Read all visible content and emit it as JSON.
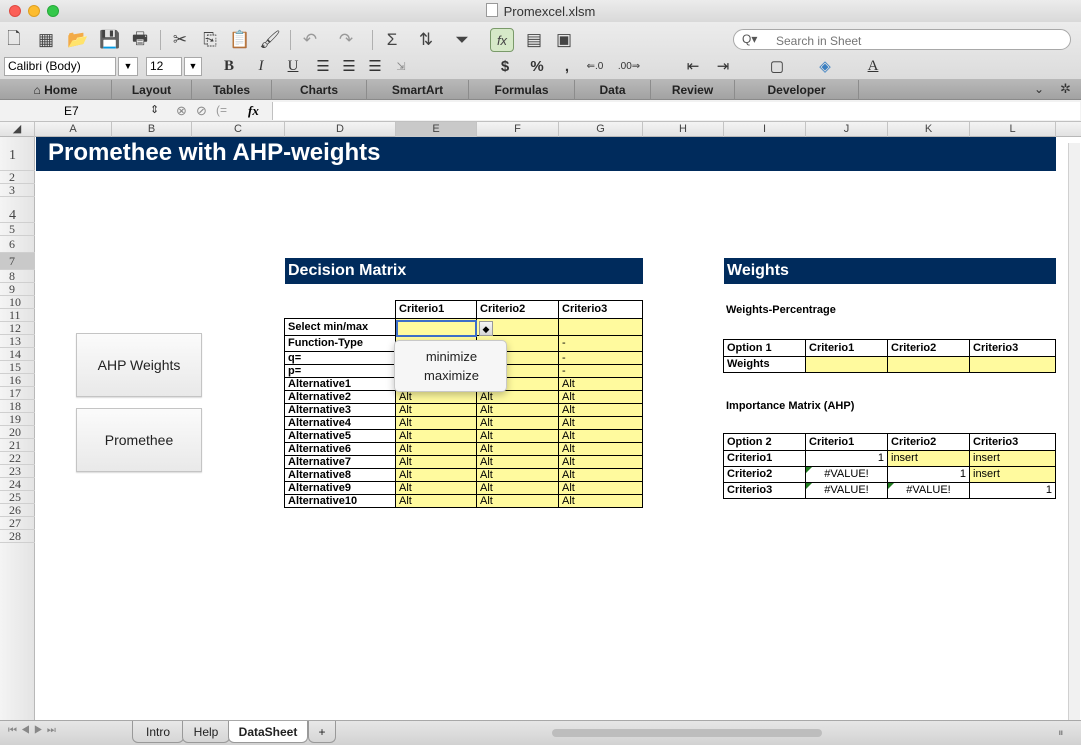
{
  "window": {
    "title": "Promexcel.xlsm"
  },
  "toolbar": {
    "search_placeholder": "Search in Sheet",
    "search_glyph": "Q▾"
  },
  "format": {
    "font_name": "Calibri (Body)",
    "font_size": "12",
    "bold": "B",
    "italic": "I",
    "underline": "U",
    "currency": "$",
    "percent": "%",
    "comma": ",",
    "font_color": "A"
  },
  "ribbon_tabs": [
    "Home",
    "Layout",
    "Tables",
    "Charts",
    "SmartArt",
    "Formulas",
    "Data",
    "Review",
    "Developer"
  ],
  "formula_bar": {
    "cell_ref": "E7",
    "fx": "fx",
    "formula": ""
  },
  "columns": [
    "A",
    "B",
    "C",
    "D",
    "E",
    "F",
    "G",
    "H",
    "I",
    "J",
    "K",
    "L"
  ],
  "selected_column": "E",
  "rows": [
    "1",
    "2",
    "3",
    "4",
    "5",
    "6",
    "7",
    "8",
    "9",
    "10",
    "11",
    "12",
    "13",
    "14",
    "15",
    "16",
    "17",
    "18",
    "19",
    "20",
    "21",
    "22",
    "23",
    "24",
    "25",
    "26",
    "27",
    "28"
  ],
  "selected_row": "7",
  "sheet": {
    "title": "Promethee with AHP-weights",
    "buttons": {
      "ahp": "AHP Weights",
      "promethee": "Promethee"
    },
    "decision_matrix": {
      "heading": "Decision Matrix",
      "header": [
        "",
        "Criterio1",
        "Criterio2",
        "Criterio3"
      ],
      "param_rows": [
        {
          "label": "Select min/max",
          "values": [
            "",
            "",
            ""
          ]
        },
        {
          "label": "Function-Type",
          "values": [
            "",
            "",
            "-"
          ]
        },
        {
          "label": "q=",
          "values": [
            "",
            "",
            "-"
          ]
        },
        {
          "label": "p=",
          "values": [
            "",
            "",
            "-"
          ]
        }
      ],
      "alternatives": [
        {
          "label": "Alternative1",
          "values": [
            "Alt",
            "Alt",
            "Alt"
          ]
        },
        {
          "label": "Alternative2",
          "values": [
            "Alt",
            "Alt",
            "Alt"
          ]
        },
        {
          "label": "Alternative3",
          "values": [
            "Alt",
            "Alt",
            "Alt"
          ]
        },
        {
          "label": "Alternative4",
          "values": [
            "Alt",
            "Alt",
            "Alt"
          ]
        },
        {
          "label": "Alternative5",
          "values": [
            "Alt",
            "Alt",
            "Alt"
          ]
        },
        {
          "label": "Alternative6",
          "values": [
            "Alt",
            "Alt",
            "Alt"
          ]
        },
        {
          "label": "Alternative7",
          "values": [
            "Alt",
            "Alt",
            "Alt"
          ]
        },
        {
          "label": "Alternative8",
          "values": [
            "Alt",
            "Alt",
            "Alt"
          ]
        },
        {
          "label": "Alternative9",
          "values": [
            "Alt",
            "Alt",
            "Alt"
          ]
        },
        {
          "label": "Alternative10",
          "values": [
            "Alt",
            "Alt",
            "Alt"
          ]
        }
      ]
    },
    "dropdown": {
      "items": [
        "minimize",
        "maximize"
      ]
    },
    "weights": {
      "heading": "Weights",
      "subheading": "Weights-Percentrage",
      "table": {
        "header": [
          "Option 1",
          "Criterio1",
          "Criterio2",
          "Criterio3"
        ],
        "rows": [
          {
            "label": "Weights",
            "values": [
              "",
              "",
              ""
            ]
          }
        ]
      },
      "importance_heading": "Importance Matrix (AHP)",
      "importance": {
        "header": [
          "Option 2",
          "Criterio1",
          "Criterio2",
          "Criterio3"
        ],
        "rows": [
          {
            "label": "Criterio1",
            "values": [
              "1",
              "insert",
              "insert"
            ]
          },
          {
            "label": "Criterio2",
            "values": [
              "#VALUE!",
              "1",
              "insert"
            ]
          },
          {
            "label": "Criterio3",
            "values": [
              "#VALUE!",
              "#VALUE!",
              "1"
            ]
          }
        ]
      }
    }
  },
  "sheet_tabs": [
    "Intro",
    "Help",
    "DataSheet",
    "+"
  ],
  "active_sheet": "DataSheet",
  "colors": {
    "title_band": "#002b5c",
    "input_yellow": "#fffa9e",
    "error_marker": "#1f7a1f"
  }
}
